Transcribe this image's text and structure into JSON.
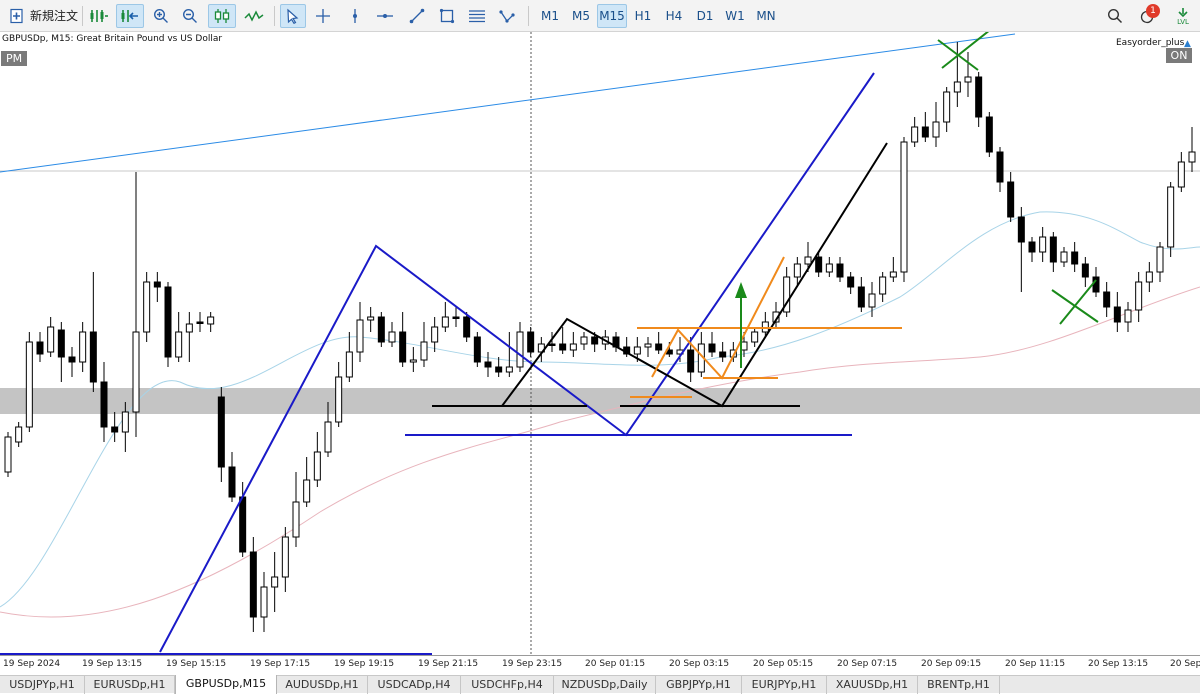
{
  "toolbar": {
    "new_order_label": "新規注文",
    "notification_count": "1",
    "timeframes": [
      "M1",
      "M5",
      "M15",
      "H1",
      "H4",
      "D1",
      "W1",
      "MN"
    ],
    "active_timeframe": "M15",
    "icons": [
      "new-order-icon",
      "depth-of-market-icon",
      "one-click-trading-icon",
      "zoom-in-icon",
      "zoom-out-icon",
      "candlestick-chart-icon",
      "line-chart-icon",
      "cursor-icon",
      "crosshair-icon",
      "vertical-line-icon",
      "horizontal-line-icon",
      "trendline-icon",
      "shapes-icon",
      "fibonacci-icon",
      "pattern-icon",
      "search-icon",
      "notifications-icon",
      "algo-trading-icon"
    ],
    "algo_label": "LVL"
  },
  "chart": {
    "symbol_description": "GBPUSDp, M15:  Great Britain Pound vs US Dollar",
    "session_badge": "PM",
    "ea_name": "Easyorder_plus",
    "ea_status": "ON",
    "time_labels": [
      "19 Sep 2024",
      "19 Sep 13:15",
      "19 Sep 15:15",
      "19 Sep 17:15",
      "19 Sep 19:15",
      "19 Sep 21:15",
      "19 Sep 23:15",
      "20 Sep 01:15",
      "20 Sep 03:15",
      "20 Sep 05:15",
      "20 Sep 07:15",
      "20 Sep 09:15",
      "20 Sep 11:15",
      "20 Sep 13:15",
      "20 Sep"
    ],
    "colors": {
      "bull": "#ffffff",
      "bear": "#000000",
      "pattern_blue": "#1a1ac8",
      "pattern_orange": "#f08a1c",
      "arrow_green": "#1a8a1a",
      "zone_gray": "#c4c4c4",
      "trend_blue": "#2b8be6"
    }
  },
  "tabs": {
    "items": [
      "USDJPYp,H1",
      "EURUSDp,H1",
      "GBPUSDp,M15",
      "AUDUSDp,H1",
      "USDCADp,H4",
      "USDCHFp,H4",
      "NZDUSDp,Daily",
      "GBPJPYp,H1",
      "EURJPYp,H1",
      "XAUUSDp,H1",
      "BRENTp,H1"
    ],
    "active": "GBPUSDp,M15"
  }
}
